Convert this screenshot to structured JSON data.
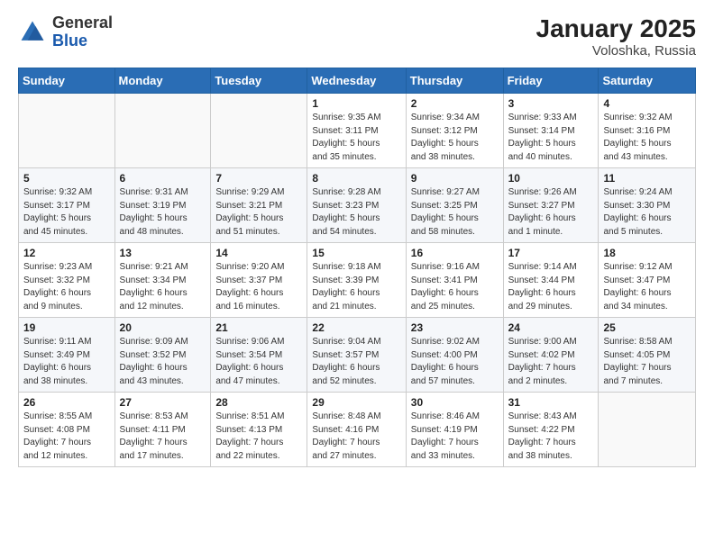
{
  "header": {
    "logo_general": "General",
    "logo_blue": "Blue",
    "month": "January 2025",
    "location": "Voloshka, Russia"
  },
  "days_of_week": [
    "Sunday",
    "Monday",
    "Tuesday",
    "Wednesday",
    "Thursday",
    "Friday",
    "Saturday"
  ],
  "weeks": [
    [
      {
        "day": "",
        "info": ""
      },
      {
        "day": "",
        "info": ""
      },
      {
        "day": "",
        "info": ""
      },
      {
        "day": "1",
        "info": "Sunrise: 9:35 AM\nSunset: 3:11 PM\nDaylight: 5 hours\nand 35 minutes."
      },
      {
        "day": "2",
        "info": "Sunrise: 9:34 AM\nSunset: 3:12 PM\nDaylight: 5 hours\nand 38 minutes."
      },
      {
        "day": "3",
        "info": "Sunrise: 9:33 AM\nSunset: 3:14 PM\nDaylight: 5 hours\nand 40 minutes."
      },
      {
        "day": "4",
        "info": "Sunrise: 9:32 AM\nSunset: 3:16 PM\nDaylight: 5 hours\nand 43 minutes."
      }
    ],
    [
      {
        "day": "5",
        "info": "Sunrise: 9:32 AM\nSunset: 3:17 PM\nDaylight: 5 hours\nand 45 minutes."
      },
      {
        "day": "6",
        "info": "Sunrise: 9:31 AM\nSunset: 3:19 PM\nDaylight: 5 hours\nand 48 minutes."
      },
      {
        "day": "7",
        "info": "Sunrise: 9:29 AM\nSunset: 3:21 PM\nDaylight: 5 hours\nand 51 minutes."
      },
      {
        "day": "8",
        "info": "Sunrise: 9:28 AM\nSunset: 3:23 PM\nDaylight: 5 hours\nand 54 minutes."
      },
      {
        "day": "9",
        "info": "Sunrise: 9:27 AM\nSunset: 3:25 PM\nDaylight: 5 hours\nand 58 minutes."
      },
      {
        "day": "10",
        "info": "Sunrise: 9:26 AM\nSunset: 3:27 PM\nDaylight: 6 hours\nand 1 minute."
      },
      {
        "day": "11",
        "info": "Sunrise: 9:24 AM\nSunset: 3:30 PM\nDaylight: 6 hours\nand 5 minutes."
      }
    ],
    [
      {
        "day": "12",
        "info": "Sunrise: 9:23 AM\nSunset: 3:32 PM\nDaylight: 6 hours\nand 9 minutes."
      },
      {
        "day": "13",
        "info": "Sunrise: 9:21 AM\nSunset: 3:34 PM\nDaylight: 6 hours\nand 12 minutes."
      },
      {
        "day": "14",
        "info": "Sunrise: 9:20 AM\nSunset: 3:37 PM\nDaylight: 6 hours\nand 16 minutes."
      },
      {
        "day": "15",
        "info": "Sunrise: 9:18 AM\nSunset: 3:39 PM\nDaylight: 6 hours\nand 21 minutes."
      },
      {
        "day": "16",
        "info": "Sunrise: 9:16 AM\nSunset: 3:41 PM\nDaylight: 6 hours\nand 25 minutes."
      },
      {
        "day": "17",
        "info": "Sunrise: 9:14 AM\nSunset: 3:44 PM\nDaylight: 6 hours\nand 29 minutes."
      },
      {
        "day": "18",
        "info": "Sunrise: 9:12 AM\nSunset: 3:47 PM\nDaylight: 6 hours\nand 34 minutes."
      }
    ],
    [
      {
        "day": "19",
        "info": "Sunrise: 9:11 AM\nSunset: 3:49 PM\nDaylight: 6 hours\nand 38 minutes."
      },
      {
        "day": "20",
        "info": "Sunrise: 9:09 AM\nSunset: 3:52 PM\nDaylight: 6 hours\nand 43 minutes."
      },
      {
        "day": "21",
        "info": "Sunrise: 9:06 AM\nSunset: 3:54 PM\nDaylight: 6 hours\nand 47 minutes."
      },
      {
        "day": "22",
        "info": "Sunrise: 9:04 AM\nSunset: 3:57 PM\nDaylight: 6 hours\nand 52 minutes."
      },
      {
        "day": "23",
        "info": "Sunrise: 9:02 AM\nSunset: 4:00 PM\nDaylight: 6 hours\nand 57 minutes."
      },
      {
        "day": "24",
        "info": "Sunrise: 9:00 AM\nSunset: 4:02 PM\nDaylight: 7 hours\nand 2 minutes."
      },
      {
        "day": "25",
        "info": "Sunrise: 8:58 AM\nSunset: 4:05 PM\nDaylight: 7 hours\nand 7 minutes."
      }
    ],
    [
      {
        "day": "26",
        "info": "Sunrise: 8:55 AM\nSunset: 4:08 PM\nDaylight: 7 hours\nand 12 minutes."
      },
      {
        "day": "27",
        "info": "Sunrise: 8:53 AM\nSunset: 4:11 PM\nDaylight: 7 hours\nand 17 minutes."
      },
      {
        "day": "28",
        "info": "Sunrise: 8:51 AM\nSunset: 4:13 PM\nDaylight: 7 hours\nand 22 minutes."
      },
      {
        "day": "29",
        "info": "Sunrise: 8:48 AM\nSunset: 4:16 PM\nDaylight: 7 hours\nand 27 minutes."
      },
      {
        "day": "30",
        "info": "Sunrise: 8:46 AM\nSunset: 4:19 PM\nDaylight: 7 hours\nand 33 minutes."
      },
      {
        "day": "31",
        "info": "Sunrise: 8:43 AM\nSunset: 4:22 PM\nDaylight: 7 hours\nand 38 minutes."
      },
      {
        "day": "",
        "info": ""
      }
    ]
  ]
}
